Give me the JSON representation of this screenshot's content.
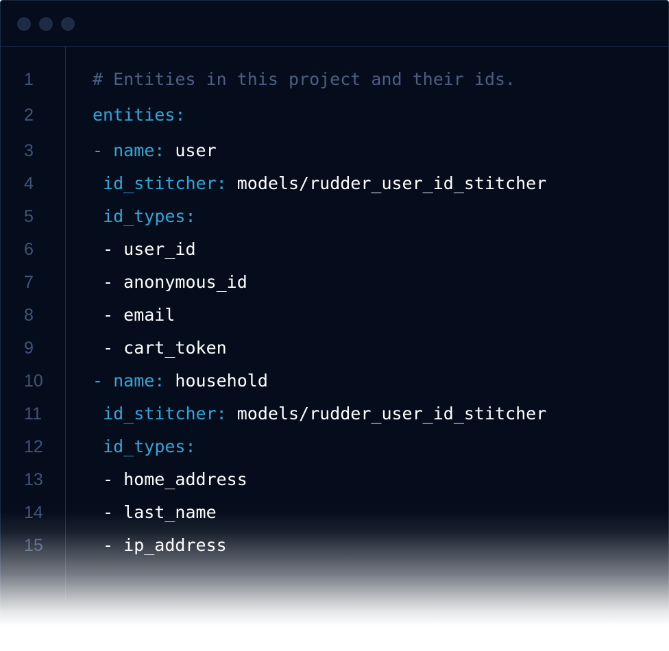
{
  "window": {
    "controls": [
      "close-dot",
      "minimize-dot",
      "maximize-dot"
    ]
  },
  "code": {
    "lines": [
      {
        "num": "1",
        "parts": [
          {
            "t": "comment",
            "text": "# Entities in this project and their ids."
          }
        ]
      },
      {
        "num": "2",
        "parts": [
          {
            "t": "key",
            "text": "entities:"
          }
        ]
      },
      {
        "num": "3",
        "parts": [
          {
            "t": "key",
            "text": "- name:"
          },
          {
            "t": "val",
            "text": " user"
          }
        ]
      },
      {
        "num": "4",
        "parts": [
          {
            "t": "val",
            "text": " "
          },
          {
            "t": "key",
            "text": "id_stitcher:"
          },
          {
            "t": "val",
            "text": " models/rudder_user_id_stitcher"
          }
        ]
      },
      {
        "num": "5",
        "parts": [
          {
            "t": "val",
            "text": " "
          },
          {
            "t": "key",
            "text": "id_types:"
          }
        ]
      },
      {
        "num": "6",
        "parts": [
          {
            "t": "val",
            "text": " - user_id"
          }
        ]
      },
      {
        "num": "7",
        "parts": [
          {
            "t": "val",
            "text": " - anonymous_id"
          }
        ]
      },
      {
        "num": "8",
        "parts": [
          {
            "t": "val",
            "text": " - email"
          }
        ]
      },
      {
        "num": "9",
        "parts": [
          {
            "t": "val",
            "text": " - cart_token"
          }
        ]
      },
      {
        "num": "10",
        "parts": [
          {
            "t": "key",
            "text": "- name:"
          },
          {
            "t": "val",
            "text": " household"
          }
        ]
      },
      {
        "num": "11",
        "parts": [
          {
            "t": "val",
            "text": " "
          },
          {
            "t": "key",
            "text": "id_stitcher:"
          },
          {
            "t": "val",
            "text": " models/rudder_user_id_stitcher"
          }
        ]
      },
      {
        "num": "12",
        "parts": [
          {
            "t": "val",
            "text": " "
          },
          {
            "t": "key",
            "text": "id_types:"
          }
        ]
      },
      {
        "num": "13",
        "parts": [
          {
            "t": "val",
            "text": " - home_address"
          }
        ]
      },
      {
        "num": "14",
        "parts": [
          {
            "t": "val",
            "text": " - last_name"
          }
        ]
      },
      {
        "num": "15",
        "parts": [
          {
            "t": "val",
            "text": " - ip_address"
          }
        ]
      }
    ]
  },
  "colors": {
    "background": "#050d1c",
    "key": "#2fa6d8",
    "comment": "#4a5f83",
    "value": "#ffffff",
    "line_number": "#3f5577"
  }
}
